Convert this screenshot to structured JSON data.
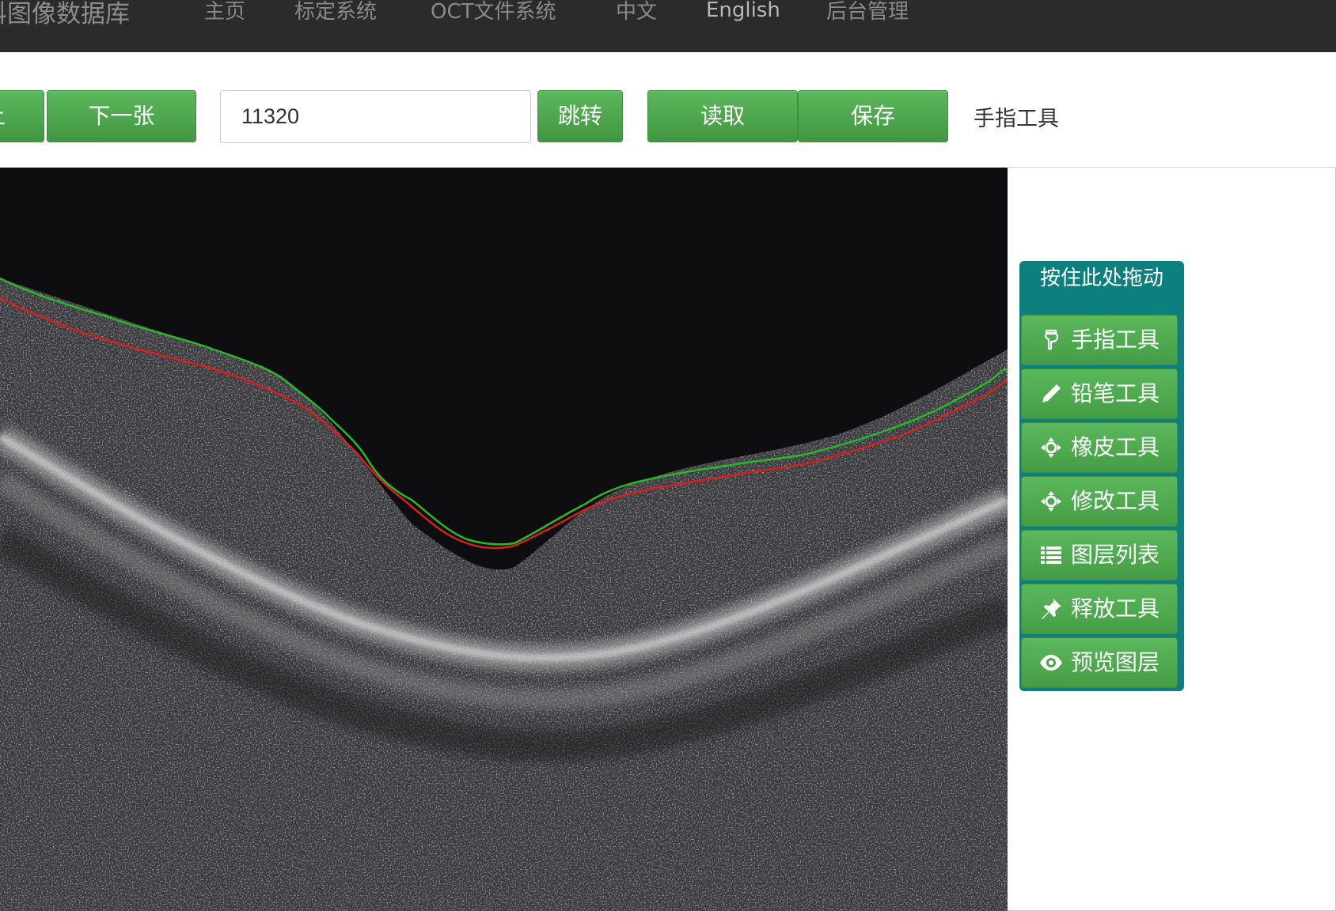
{
  "navbar": {
    "brand": "科图像数据库",
    "links": [
      {
        "label": "主页"
      },
      {
        "label": "标定系统"
      },
      {
        "label": "OCT文件系统"
      },
      {
        "label": "中文"
      },
      {
        "label": "English"
      },
      {
        "label": "后台管理"
      }
    ]
  },
  "toolbar": {
    "prev_label": "上",
    "next_label": "下一张",
    "jump_value": "11320",
    "jump_label": "跳转",
    "read_label": "读取",
    "save_label": "保存",
    "current_tool": "手指工具"
  },
  "tool_panel": {
    "drag_label": "按住此处拖动",
    "tools": [
      {
        "label": "手指工具",
        "icon": "hand-pointer-icon"
      },
      {
        "label": "铅笔工具",
        "icon": "pencil-icon"
      },
      {
        "label": "橡皮工具",
        "icon": "move-crosshair-icon"
      },
      {
        "label": "修改工具",
        "icon": "move-crosshair-icon"
      },
      {
        "label": "图层列表",
        "icon": "list-icon"
      },
      {
        "label": "释放工具",
        "icon": "pushpin-icon"
      },
      {
        "label": "预览图层",
        "icon": "eye-icon"
      }
    ]
  },
  "colors": {
    "accent_green": "#5cb85c",
    "panel_teal": "#0e7f7f",
    "navbar_bg": "#2b2b2b",
    "annotation_upper": "#27b927",
    "annotation_lower": "#d61f1f"
  }
}
